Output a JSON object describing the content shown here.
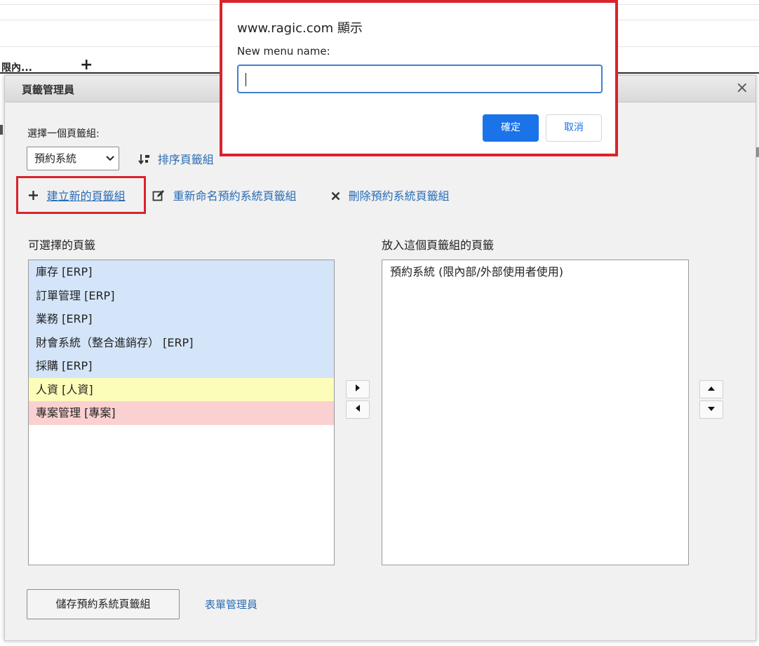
{
  "background": {
    "tab_label": "限內...",
    "plus_label": "+"
  },
  "modal": {
    "title": "頁籤管理員",
    "close_label": "×",
    "select_label": "選擇一個頁籤組:",
    "selected_group": "預約系統",
    "sort_label": "排序頁籤組",
    "actions": {
      "create": "建立新的頁籤組",
      "rename": "重新命名預約系統頁籤組",
      "delete": "刪除預約系統頁籤組"
    },
    "available_title": "可選擇的頁籤",
    "assigned_title": "放入這個頁籤組的頁籤",
    "available_items": [
      {
        "label": "庫存 [ERP]",
        "color": "#d4e5f9"
      },
      {
        "label": "訂單管理 [ERP]",
        "color": "#d4e5f9"
      },
      {
        "label": "業務 [ERP]",
        "color": "#d4e5f9"
      },
      {
        "label": "財會系統（整合進銷存） [ERP]",
        "color": "#d4e5f9"
      },
      {
        "label": "採購 [ERP]",
        "color": "#d4e5f9"
      },
      {
        "label": "人資 [人資]",
        "color": "#fdfdba"
      },
      {
        "label": "專案管理 [專案]",
        "color": "#fbd0d0"
      }
    ],
    "assigned_items": [
      {
        "label": "預約系統 (限內部/外部使用者使用)"
      }
    ],
    "save_label": "儲存預約系統頁籤組",
    "form_manager_label": "表單管理員"
  },
  "prompt": {
    "title": "www.ragic.com 顯示",
    "message": "New menu name:",
    "input_value": "",
    "ok_label": "確定",
    "cancel_label": "取消",
    "highlight_color": "#d9232d",
    "accent_color": "#1a73e8"
  }
}
